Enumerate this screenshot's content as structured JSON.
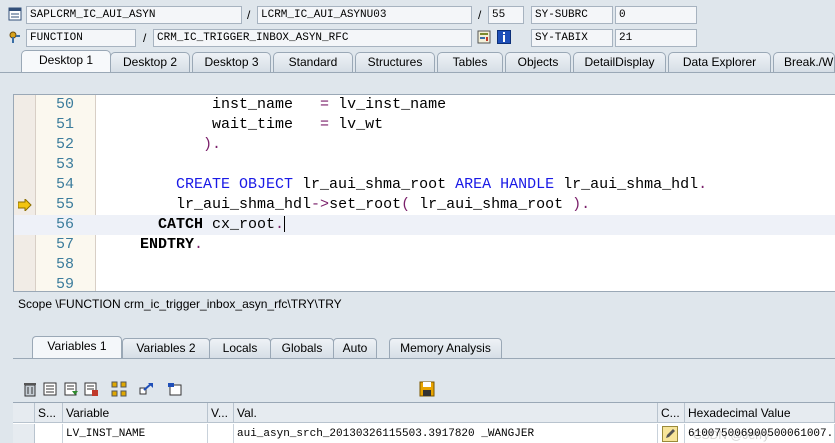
{
  "header": {
    "row1": {
      "program": "SAPLCRM_IC_AUI_ASYN",
      "sep1": "/",
      "include": "LCRM_IC_AUI_ASYNU03",
      "sep2": "/",
      "line": "55",
      "var_name": "SY-SUBRC",
      "var_value": "0"
    },
    "row2": {
      "kind": "FUNCTION",
      "sep1": "/",
      "name": "CRM_IC_TRIGGER_INBOX_ASYN_RFC",
      "var_name": "SY-TABIX",
      "var_value": "21"
    },
    "icons": [
      "document-icon",
      "function-icon",
      "watchpoint-icon",
      "info-icon"
    ]
  },
  "tabs": [
    "Desktop 1",
    "Desktop 2",
    "Desktop 3",
    "Standard",
    "Structures",
    "Tables",
    "Objects",
    "DetailDisplay",
    "Data Explorer",
    "Break./W"
  ],
  "active_tab": "Desktop 1",
  "code": {
    "lines": [
      {
        "n": "50",
        "parts": [
          [
            "id",
            "            inst_name   "
          ],
          [
            "pu",
            "= "
          ],
          [
            "id",
            "lv_inst_name"
          ]
        ]
      },
      {
        "n": "51",
        "parts": [
          [
            "id",
            "            wait_time   "
          ],
          [
            "pu",
            "= "
          ],
          [
            "id",
            "lv_wt"
          ]
        ]
      },
      {
        "n": "52",
        "parts": [
          [
            "pu",
            "           )."
          ]
        ]
      },
      {
        "n": "53",
        "parts": []
      },
      {
        "n": "54",
        "parts": [
          [
            "kw",
            "        CREATE OBJECT "
          ],
          [
            "id",
            "lr_aui_shma_root "
          ],
          [
            "kw",
            "AREA HANDLE "
          ],
          [
            "id",
            "lr_aui_shma_hdl"
          ],
          [
            "pu",
            "."
          ]
        ]
      },
      {
        "n": "55",
        "parts": [
          [
            "id",
            "        lr_aui_shma_hdl"
          ],
          [
            "pu",
            "->"
          ],
          [
            "id",
            "set_root"
          ],
          [
            "pu",
            "( "
          ],
          [
            "id",
            "lr_aui_shma_root "
          ],
          [
            "pu",
            ")."
          ]
        ]
      },
      {
        "n": "56",
        "parts": [
          [
            "kwb",
            "      CATCH "
          ],
          [
            "id",
            "cx_root"
          ],
          [
            "pu",
            "."
          ]
        ]
      },
      {
        "n": "57",
        "parts": [
          [
            "kwb",
            "    ENDTRY"
          ],
          [
            "pu",
            "."
          ]
        ]
      },
      {
        "n": "58",
        "parts": []
      },
      {
        "n": "59",
        "parts": []
      }
    ],
    "current_line": "56",
    "exec_line": "55"
  },
  "scope": "Scope \\FUNCTION crm_ic_trigger_inbox_asyn_rfc\\TRY\\TRY",
  "lower_tabs": [
    "Variables 1",
    "Variables 2",
    "Locals",
    "Globals",
    "Auto",
    "Memory Analysis"
  ],
  "active_lower_tab": "Variables 1",
  "toolbar_icons": [
    "delete-icon",
    "delete-all-icon",
    "load-icon",
    "save-layout-icon",
    "hierarchy-icon",
    "navigate-icon",
    "new-tool-icon",
    "save-icon"
  ],
  "grid": {
    "headers": [
      "S...",
      "Variable",
      "V...",
      "Val.",
      "C...",
      "Hexadecimal Value"
    ],
    "rows": [
      {
        "status": "",
        "variable": "LV_INST_NAME",
        "v": "",
        "value": "aui_asyn_srch_20130326115503.3917820 _WANGJER",
        "change": "",
        "hex": "610075006900500061007..."
      }
    ]
  },
  "watermark": "CSDN @Jerry"
}
